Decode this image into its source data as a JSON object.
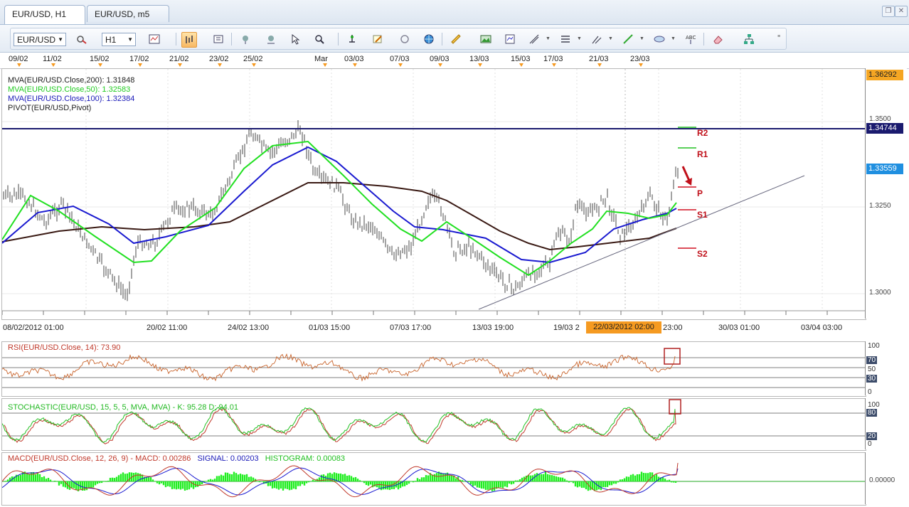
{
  "tabs": [
    {
      "label": "EUR/USD, H1",
      "active": true
    },
    {
      "label": "EUR/USD, m5",
      "active": false
    }
  ],
  "toolbar": {
    "symbol": "EUR/USD",
    "timeframe": "H1",
    "icons": [
      "chart-type-icon",
      "zoom-icon",
      "indicator-icon",
      "bar-icon",
      "candle-icon",
      "line-icon",
      "hand-icon",
      "hand2-icon",
      "cursor-icon",
      "zoom-rect-icon",
      "pin-icon",
      "crosshair-icon",
      "refresh-icon",
      "globe-icon",
      "ruler-icon",
      "picture-icon",
      "template-icon",
      "fib-icon",
      "level-icon",
      "channel-icon",
      "trendline-icon",
      "ellipse-icon",
      "text-icon",
      "eraser-icon",
      "tree-icon"
    ]
  },
  "top_dates": [
    "09/02",
    "11/02",
    "15/02",
    "17/02",
    "21/02",
    "23/02",
    "25/02",
    "Mar",
    "03/03",
    "07/03",
    "09/03",
    "13/03",
    "15/03",
    "17/03",
    "21/03",
    "23/03"
  ],
  "main": {
    "legend": [
      {
        "text": "MVA(EUR/USD.Close,200): 1.31848",
        "color": "#222222"
      },
      {
        "text": "MVA(EUR/USD.Close,50): 1.32583",
        "color": "#22cc22"
      },
      {
        "text": "MVA(EUR/USD.Close,100): 1.32384",
        "color": "#1a1ab8"
      },
      {
        "text": "PIVOT(EUR/USD,Pivot)",
        "color": "#222222"
      }
    ],
    "price_axis": [
      "1.3500",
      "1.3250",
      "1.3000"
    ],
    "price_tags": [
      {
        "text": "1.36292",
        "bg": "#f5a623",
        "color": "#222222"
      },
      {
        "text": "1.34744",
        "bg": "#1a1a6e",
        "color": "#ffffff"
      },
      {
        "text": "1.33559",
        "bg": "#1f8fe0",
        "color": "#ffffff"
      }
    ],
    "pivots": [
      "R2",
      "R1",
      "P",
      "S1",
      "S2"
    ],
    "time_labels": [
      "08/02/2012 01:00",
      "20/02 11:00",
      "24/02 13:00",
      "01/03 15:00",
      "07/03 17:00",
      "13/03 19:00",
      "19/03 2",
      "23:00",
      "30/03 01:00",
      "03/04 03:00"
    ],
    "highlight_time": "22/03/2012 02:00"
  },
  "rsi": {
    "title": "RSI(EUR/USD.Close, 14): 73.90",
    "scale": [
      "100",
      "70",
      "50",
      "30",
      "0"
    ]
  },
  "stoch": {
    "title": "STOCHASTIC(EUR/USD, 15, 5, 5, MVA, MVA) -  K: 95.28  D: 94.01",
    "scale": [
      "100",
      "80",
      "20",
      "0"
    ]
  },
  "macd": {
    "title_macd": "MACD(EUR/USD.Close, 12, 26, 9) -  MACD: 0.00286",
    "title_signal": "SIGNAL: 0.00203",
    "title_hist": "HISTOGRAM: 0.00083",
    "scale": [
      "0.00000"
    ]
  }
}
